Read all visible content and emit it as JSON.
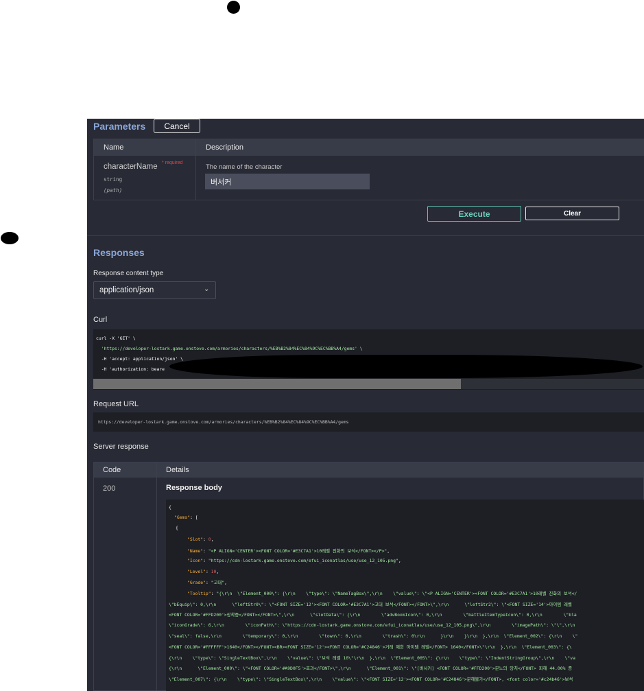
{
  "parameters": {
    "title": "Parameters",
    "cancel_label": "Cancel",
    "table_headers": {
      "name": "Name",
      "description": "Description"
    },
    "param": {
      "name": "characterName",
      "required": "* required",
      "type": "string",
      "in": "(path)",
      "description": "The name of the character",
      "value": "버서커"
    },
    "execute_label": "Execute",
    "clear_label": "Clear"
  },
  "responses": {
    "title": "Responses",
    "content_type_label": "Response content type",
    "content_type_value": "application/json",
    "curl_label": "Curl",
    "curl_lines": [
      "curl -X 'GET' \\",
      "  'https://developer-lostark.game.onstove.com/armories/characters/%EB%B2%84%EC%84%9C%EC%BB%A4/gems' \\",
      "  -H 'accept: application/json' \\",
      "  -H 'authorization: beare"
    ],
    "request_url_label": "Request URL",
    "request_url": "https://developer-lostark.game.onstove.com/armories/characters/%EB%B2%84%EC%84%9C%EC%BB%A4/gems",
    "server_response_label": "Server response",
    "table_headers": {
      "code": "Code",
      "details": "Details"
    },
    "code": "200",
    "response_body_label": "Response body",
    "body": {
      "open": "{",
      "gems_key": "\"Gems\"",
      "gems_open": ": [",
      "obj_open": "{",
      "slot_key": "\"Slot\"",
      "slot_value": "0",
      "name_key": "\"Name\"",
      "name_value": "\"<P ALIGN='CENTER'><FONT COLOR='#E3C7A1'>10레벨 진화의 보석</FONT></P>\"",
      "icon_key": "\"Icon\"",
      "icon_value": "\"https://cdn-lostark.game.onstove.com/efui_iconatlas/use/use_12_105.png\"",
      "level_key": "\"Level\"",
      "level_value": "10",
      "grade_key": "\"Grade\"",
      "grade_value": "\"고대\"",
      "tooltip_key": "\"Tooltip\"",
      "tooltip_lines": [
        "\"{\\r\\n  \\\"Element_000\\\": {\\r\\n    \\\"type\\\": \\\"NameTagBox\\\",\\r\\n    \\\"value\\\": \\\"<P ALIGN='CENTER'><FONT COLOR='#E3C7A1'>10레벨 진화의 보석</",
        "\\\"bEquip\\\": 0,\\r\\n      \\\"leftStr0\\\": \\\"<FONT SIZE='12'><FONT COLOR='#E3C7A1'>고대 보석</FONT></FONT>\\\",\\r\\n      \\\"leftStr2\\\": \\\"<FONT SIZE='14'>아이템 레벨",
        "<FONT COLOR='#FFD200'>장착중</FONT></FONT>\\\",\\r\\n      \\\"slotData\\\": {\\r\\n        \\\"advBookIcon\\\": 0,\\r\\n        \\\"battleItemTypeIcon\\\": 0,\\r\\n        \\\"bla",
        "\\\"iconGrade\\\": 6,\\r\\n        \\\"iconPath\\\": \\\"https://cdn-lostark.game.onstove.com/efui_iconatlas/use/use_12_105.png\\\",\\r\\n        \\\"imagePath\\\": \\\"\\\",\\r\\n",
        "\\\"seal\\\": false,\\r\\n        \\\"temporary\\\": 0,\\r\\n        \\\"town\\\": 0,\\r\\n        \\\"trash\\\": 0\\r\\n      }\\r\\n    }\\r\\n  },\\r\\n  \\\"Element_002\\\": {\\r\\n    \\\"",
        "<FONT COLOR='#FFFFFF'>1640</FONT></FONT><BR><FONT SIZE='12'><FONT COLOR='#C24846'>거래 제한 아이템 레벨</FONT> 1640</FONT>\\\"\\r\\n  },\\r\\n  \\\"Element_003\\\": {\\",
        "{\\r\\n    \\\"type\\\": \\\"SingleTextBox\\\",\\r\\n    \\\"value\\\": \\\"보석 레벨 10\\\"\\r\\n  },\\r\\n  \\\"Element_005\\\": {\\r\\n    \\\"type\\\": \\\"IndentStringGroup\\\",\\r\\n    \\\"va",
        "{\\r\\n      \\\"Element_000\\\": \\\"<FONT COLOR='#A9D0F5'>효과</FONT>\\\",\\r\\n      \\\"Element_001\\\": \\\"[버서커] <FONT COLOR='#FFD200'>분노의 망치</FONT> 피해 44.00% 증",
        "\\\"Element_007\\\": {\\r\\n    \\\"type\\\": \\\"SingleTextBox\\\",\\r\\n    \\\"value\\\": \\\"<FONT SIZE='12'><FONT COLOR='#C24846'>분해불가</FONT>, <font color='#c24b46'>보석"
      ]
    }
  }
}
